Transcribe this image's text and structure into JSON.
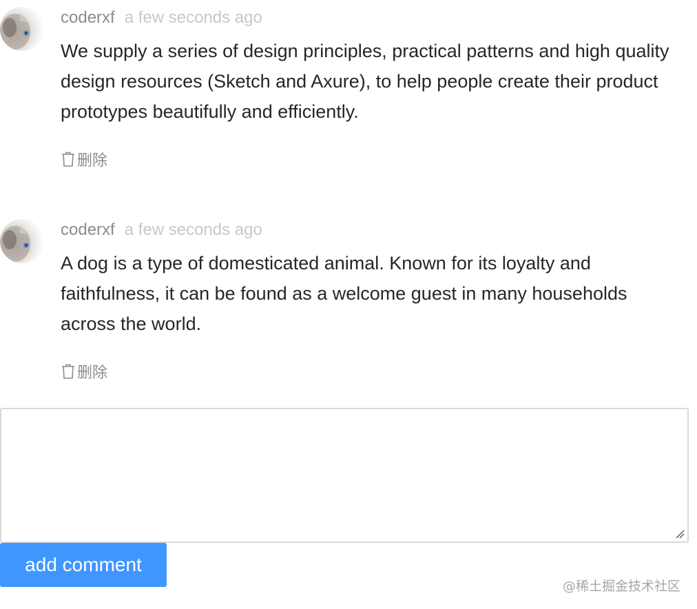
{
  "comments": [
    {
      "author": "coderxf",
      "time": "a few seconds ago",
      "content": "We supply a series of design principles, practical patterns and high quality design resources (Sketch and Axure), to help people create their product prototypes beautifully and efficiently.",
      "delete_label": "删除",
      "avatar_icon": "cat-avatar-icon"
    },
    {
      "author": "coderxf",
      "time": "a few seconds ago",
      "content": "A dog is a type of domesticated animal. Known for its loyalty and faithfulness, it can be found as a welcome guest in many households across the world.",
      "delete_label": "删除",
      "avatar_icon": "cat-avatar-icon"
    }
  ],
  "editor": {
    "value": "",
    "placeholder": ""
  },
  "submit_label": "add comment",
  "watermark": "@稀土掘金技术社区",
  "colors": {
    "accent": "#4096ff",
    "author": "#8c8c8c",
    "time": "#c8c8c8",
    "text": "#262626",
    "border": "#d9d9d9"
  }
}
